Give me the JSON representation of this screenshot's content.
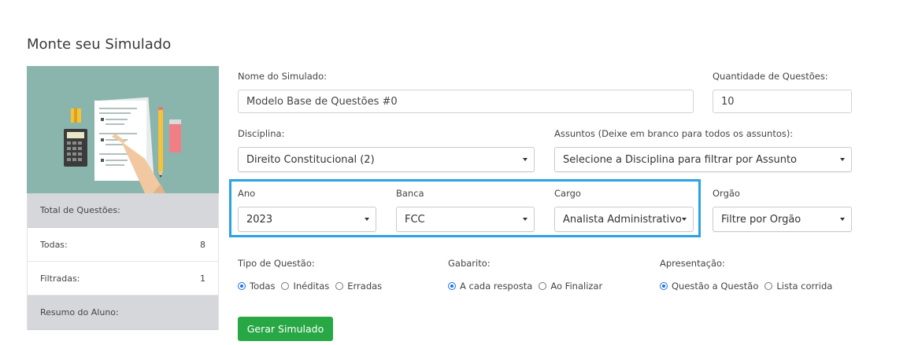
{
  "page": {
    "title": "Monte seu Simulado"
  },
  "sidebar": {
    "total_label": "Total de Questões:",
    "rows": [
      {
        "label": "Todas:",
        "value": "8"
      },
      {
        "label": "Filtradas:",
        "value": "1"
      }
    ],
    "resumo_label": "Resumo do Aluno:"
  },
  "form": {
    "nome": {
      "label": "Nome do Simulado:",
      "value": "Modelo Base de Questões #0"
    },
    "quantidade": {
      "label": "Quantidade de Questões:",
      "value": "10"
    },
    "disciplina": {
      "label": "Disciplina:",
      "value": "Direito Constitucional (2)"
    },
    "assuntos": {
      "label": "Assuntos (Deixe em branco para todos os assuntos):",
      "value": "Selecione a Disciplina para filtrar por Assunto"
    },
    "ano": {
      "label": "Ano",
      "value": "2023"
    },
    "banca": {
      "label": "Banca",
      "value": "FCC"
    },
    "cargo": {
      "label": "Cargo",
      "value": "Analista Administrativo"
    },
    "orgao": {
      "label": "Orgão",
      "value": "Filtre por Orgão"
    },
    "tipo": {
      "label": "Tipo de Questão:",
      "options": [
        "Todas",
        "Inéditas",
        "Erradas"
      ],
      "selected": "Todas"
    },
    "gabarito": {
      "label": "Gabarito:",
      "options": [
        "A cada resposta",
        "Ao Finalizar"
      ],
      "selected": "A cada resposta"
    },
    "apresentacao": {
      "label": "Apresentação:",
      "options": [
        "Questão a Questão",
        "Lista corrida"
      ],
      "selected": "Questão a Questão"
    },
    "submit_label": "Gerar Simulado"
  },
  "colors": {
    "highlight": "#2aa3e0",
    "button": "#28a745",
    "illustration_bg": "#8ab5ac",
    "radio_selected": "#1a73e8"
  }
}
